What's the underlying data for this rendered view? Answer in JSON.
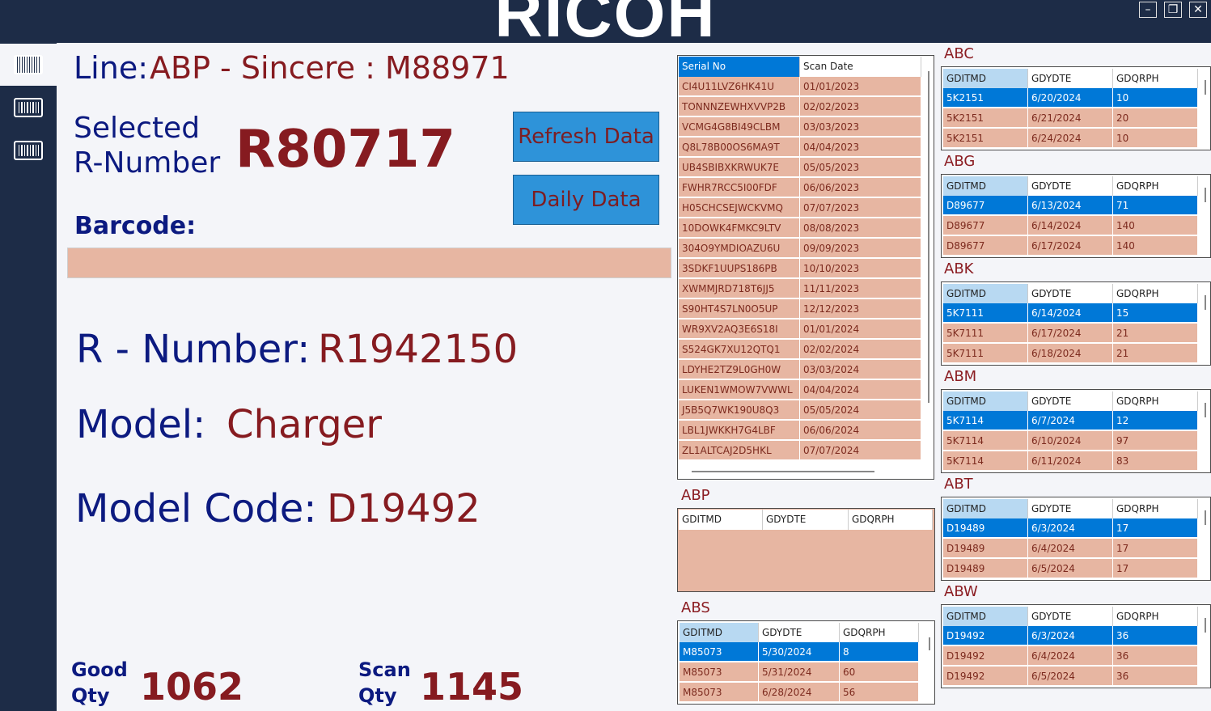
{
  "window": {
    "logo": "RICOH",
    "minimize": "–",
    "restore": "❐",
    "close": "✕"
  },
  "sidebar": [
    {
      "icon": "barcode-icon"
    },
    {
      "icon": "barcode-icon"
    },
    {
      "icon": "barcode-icon"
    }
  ],
  "line": {
    "label": "Line:",
    "value": "ABP - Sincere : M88971"
  },
  "selected": {
    "label1": "Selected",
    "label2": "R-Number",
    "value": "R80717"
  },
  "buttons": {
    "refresh": "Refresh Data",
    "daily": "Daily Data"
  },
  "barcode": {
    "label": "Barcode:",
    "value": ""
  },
  "rnumber": {
    "label": "R - Number:",
    "value": "R1942150"
  },
  "model": {
    "label": "Model:",
    "value": "Charger"
  },
  "model_code": {
    "label": "Model Code:",
    "value": "D19492"
  },
  "good": {
    "label1": "Good",
    "label2": "Qty",
    "value": "1062"
  },
  "scan": {
    "label1": "Scan",
    "label2": "Qty",
    "value": "1145"
  },
  "scan_grid": {
    "columns": [
      "Serial No",
      "Scan Date"
    ],
    "rows": [
      [
        "CI4U11LVZ6HK41U",
        "01/01/2023"
      ],
      [
        "TONNNZEWHXVVP2B",
        "02/02/2023"
      ],
      [
        "VCMG4G8BI49CLBM",
        "03/03/2023"
      ],
      [
        "Q8L78B00OS6MA9T",
        "04/04/2023"
      ],
      [
        "UB4SBIBXKRWUK7E",
        "05/05/2023"
      ],
      [
        "FWHR7RCC5I00FDF",
        "06/06/2023"
      ],
      [
        "H05CHCSEJWCKVMQ",
        "07/07/2023"
      ],
      [
        "10DOWK4FMKC9LTV",
        "08/08/2023"
      ],
      [
        "304O9YMDIOAZU6U",
        "09/09/2023"
      ],
      [
        "3SDKF1UUPS186PB",
        "10/10/2023"
      ],
      [
        "XWMMJRD718T6JJ5",
        "11/11/2023"
      ],
      [
        "S90HT4S7LN0O5UP",
        "12/12/2023"
      ],
      [
        "WR9XV2AQ3E6S18I",
        "01/01/2024"
      ],
      [
        "S524GK7XU12QTQ1",
        "02/02/2024"
      ],
      [
        "LDYHE2TZ9L0GH0W",
        "03/03/2024"
      ],
      [
        "LUKEN1WMOW7VWWL",
        "04/04/2024"
      ],
      [
        "J5B5Q7WK190U8Q3",
        "05/05/2024"
      ],
      [
        "LBL1JWKKH7G4LBF",
        "06/06/2024"
      ],
      [
        "ZL1ALTCAJ2D5HKL",
        "07/07/2024"
      ]
    ]
  },
  "line_grids_left": [
    {
      "caption": "ABP",
      "columns": [
        "GDITMD",
        "GDYDTE",
        "GDQRPH"
      ],
      "rows": []
    },
    {
      "caption": "ABS",
      "columns": [
        "GDITMD",
        "GDYDTE",
        "GDQRPH"
      ],
      "rows": [
        [
          "M85073",
          "5/30/2024",
          "8"
        ],
        [
          "M85073",
          "5/31/2024",
          "60"
        ],
        [
          "M85073",
          "6/28/2024",
          "56"
        ]
      ]
    }
  ],
  "line_grids_right": [
    {
      "caption": "ABC",
      "columns": [
        "GDITMD",
        "GDYDTE",
        "GDQRPH"
      ],
      "rows": [
        [
          "5K2151",
          "6/20/2024",
          "10"
        ],
        [
          "5K2151",
          "6/21/2024",
          "20"
        ],
        [
          "5K2151",
          "6/24/2024",
          "10"
        ]
      ]
    },
    {
      "caption": "ABG",
      "columns": [
        "GDITMD",
        "GDYDTE",
        "GDQRPH"
      ],
      "rows": [
        [
          "D89677",
          "6/13/2024",
          "71"
        ],
        [
          "D89677",
          "6/14/2024",
          "140"
        ],
        [
          "D89677",
          "6/17/2024",
          "140"
        ]
      ]
    },
    {
      "caption": "ABK",
      "columns": [
        "GDITMD",
        "GDYDTE",
        "GDQRPH"
      ],
      "rows": [
        [
          "5K7111",
          "6/14/2024",
          "15"
        ],
        [
          "5K7111",
          "6/17/2024",
          "21"
        ],
        [
          "5K7111",
          "6/18/2024",
          "21"
        ]
      ]
    },
    {
      "caption": "ABM",
      "columns": [
        "GDITMD",
        "GDYDTE",
        "GDQRPH"
      ],
      "rows": [
        [
          "5K7114",
          "6/7/2024",
          "12"
        ],
        [
          "5K7114",
          "6/10/2024",
          "97"
        ],
        [
          "5K7114",
          "6/11/2024",
          "83"
        ]
      ]
    },
    {
      "caption": "ABT",
      "columns": [
        "GDITMD",
        "GDYDTE",
        "GDQRPH"
      ],
      "rows": [
        [
          "D19489",
          "6/3/2024",
          "17"
        ],
        [
          "D19489",
          "6/4/2024",
          "17"
        ],
        [
          "D19489",
          "6/5/2024",
          "17"
        ]
      ]
    },
    {
      "caption": "ABW",
      "columns": [
        "GDITMD",
        "GDYDTE",
        "GDQRPH"
      ],
      "rows": [
        [
          "D19492",
          "6/3/2024",
          "36"
        ],
        [
          "D19492",
          "6/4/2024",
          "36"
        ],
        [
          "D19492",
          "6/5/2024",
          "36"
        ]
      ]
    }
  ],
  "colors": {
    "header_selected": "#0078d7",
    "row_selected": "#0078d7",
    "row": "#e7b6a2",
    "header": "#ffffff",
    "header_first": "#b8d9f2",
    "text": "#7c2a1e"
  }
}
